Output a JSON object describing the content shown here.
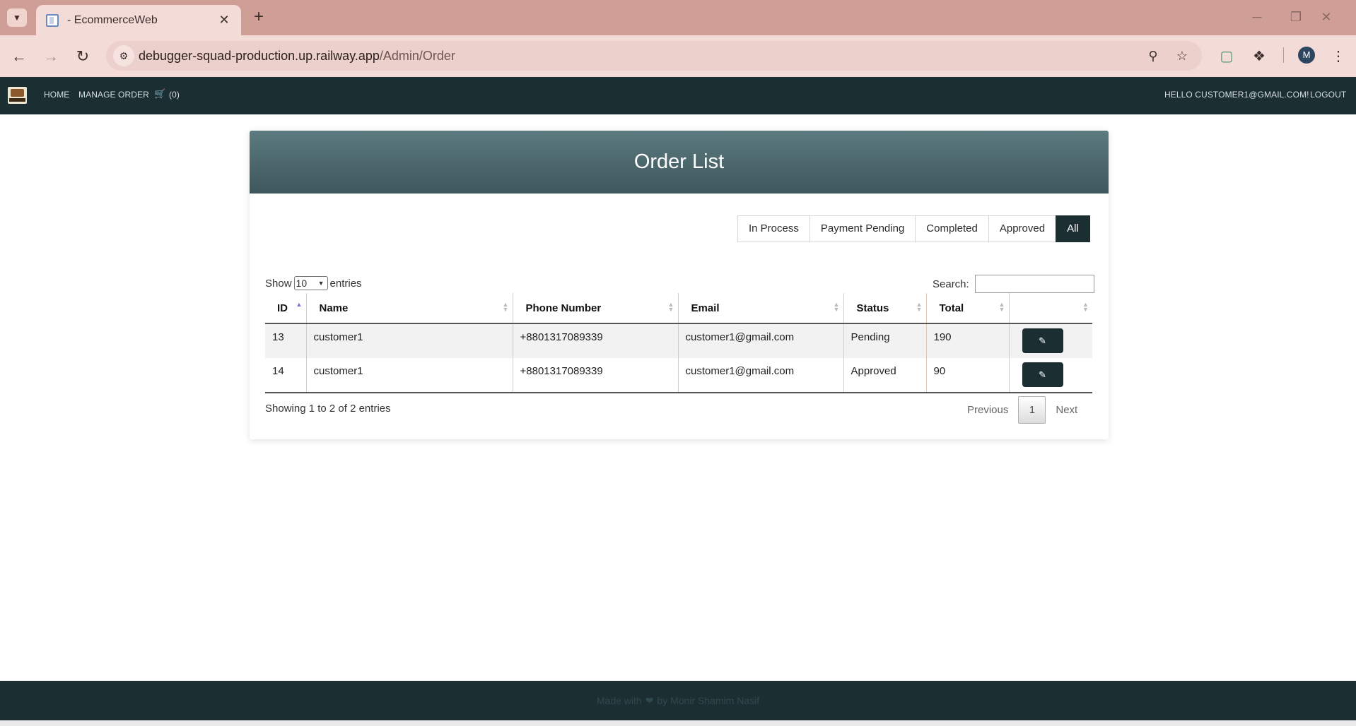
{
  "browser": {
    "tab_title": "- EcommerceWeb",
    "tab_close": "✕",
    "new_tab": "+",
    "url_domain": "debugger-squad-production.up.railway.app",
    "url_path": "/Admin/Order",
    "profile_initial": "M",
    "back_glyph": "←",
    "forward_glyph": "→",
    "reload_glyph": "↻",
    "minimize_glyph": "─",
    "restore_glyph": "❐",
    "close_glyph": "✕"
  },
  "navbar": {
    "home": "HOME",
    "manage_order": "MANAGE ORDER",
    "cart_count": "(0)",
    "greeting": "HELLO CUSTOMER1@GMAIL.COM!",
    "logout": "LOGOUT"
  },
  "card": {
    "title": "Order List"
  },
  "filters": [
    {
      "label": "In Process",
      "active": false
    },
    {
      "label": "Payment Pending",
      "active": false
    },
    {
      "label": "Completed",
      "active": false
    },
    {
      "label": "Approved",
      "active": false
    },
    {
      "label": "All",
      "active": true
    }
  ],
  "datatable": {
    "show_label": "Show",
    "entries_label": "entries",
    "page_length": "10",
    "search_label": "Search:",
    "search_value": "",
    "columns": [
      "ID",
      "Name",
      "Phone Number",
      "Email",
      "Status",
      "Total",
      ""
    ],
    "rows": [
      {
        "id": "13",
        "name": "customer1",
        "phone": "+8801317089339",
        "email": "customer1@gmail.com",
        "status": "Pending",
        "total": "190"
      },
      {
        "id": "14",
        "name": "customer1",
        "phone": "+8801317089339",
        "email": "customer1@gmail.com",
        "status": "Approved",
        "total": "90"
      }
    ],
    "info": "Showing 1 to 2 of 2 entries",
    "previous": "Previous",
    "current_page": "1",
    "next": "Next"
  },
  "footer": {
    "text_before": "Made with",
    "text_after": "by Monir Shamim Nasif"
  },
  "colors": {
    "navbar_bg": "#1b2e31",
    "header_gradient_top": "#5c7a7f",
    "header_gradient_bottom": "#3d575c",
    "chrome_tabbar": "#cf9e96",
    "chrome_toolbar": "#f3dcd8"
  }
}
